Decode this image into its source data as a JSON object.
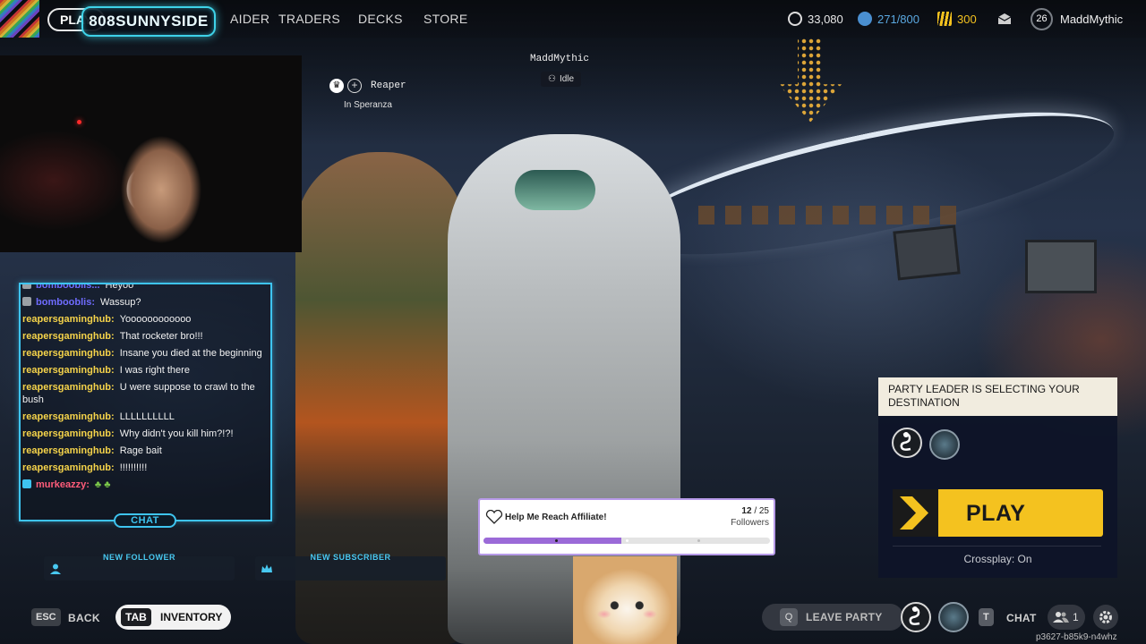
{
  "topbar": {
    "play_label": "PLAY",
    "stream_name": "808SUNNYSIDE",
    "nav": [
      "AIDER",
      "TRADERS",
      "DECKS",
      "STORE"
    ],
    "currencies": [
      {
        "icon": "coins-icon",
        "value": "33,080",
        "color": "#e8e8e8"
      },
      {
        "icon": "cred-icon",
        "value": "271/800",
        "color": "#5aa8e0"
      },
      {
        "icon": "raider-tokens-icon",
        "value": "300",
        "color": "#f4c21f"
      }
    ],
    "level": "26",
    "username": "MaddMythic"
  },
  "party": {
    "self_name": "MaddMythic",
    "self_status": "Idle",
    "member_name": "Reaper",
    "member_location": "In Speranza"
  },
  "chat": {
    "tab_label": "CHAT",
    "messages": [
      {
        "user": "bombooblis...",
        "text": "Heyoo"
      },
      {
        "user": "bombooblis:",
        "text": "Wassup?"
      },
      {
        "user": "reapersgaminghub:",
        "text": "Yoooooooooooo"
      },
      {
        "user": "reapersgaminghub:",
        "text": "That rocketer bro!!!"
      },
      {
        "user": "reapersgaminghub:",
        "text": "Insane you died at the beginning"
      },
      {
        "user": "reapersgaminghub:",
        "text": "I was right there"
      },
      {
        "user": "reapersgaminghub:",
        "text": "U were suppose to crawl to the bush"
      },
      {
        "user": "reapersgaminghub:",
        "text": "LLLLLLLLLL"
      },
      {
        "user": "reapersgaminghub:",
        "text": "Why didn't you kill him?!?!"
      },
      {
        "user": "reapersgaminghub:",
        "text": "Rage bait"
      },
      {
        "user": "reapersgaminghub:",
        "text": "!!!!!!!!!!"
      },
      {
        "user": "murkeazzy:",
        "text": ""
      }
    ]
  },
  "alerts": {
    "new_follower": "NEW FOLLOWER",
    "new_subscriber": "NEW SUBSCRIBER"
  },
  "goal": {
    "title": "Help Me Reach Affiliate!",
    "current": "12",
    "target": "/ 25",
    "unit": "Followers",
    "progress": 0.48
  },
  "lobby_panel": {
    "status": "PARTY LEADER IS SELECTING YOUR DESTINATION",
    "play_label": "PLAY",
    "crossplay": "Crossplay: On"
  },
  "bottom": {
    "back_key": "ESC",
    "back_label": "BACK",
    "inventory_key": "TAB",
    "inventory_label": "INVENTORY",
    "leave_key": "Q",
    "leave_label": "LEAVE PARTY",
    "chat_key": "T",
    "chat_label": "CHAT",
    "friends_count": "1",
    "build_id": "p3627-b85k9-n4whz"
  },
  "colors": {
    "accent_yellow": "#f4c21f",
    "overlay_cyan": "#3ec4f0",
    "goal_purple": "#9b6ad8"
  }
}
